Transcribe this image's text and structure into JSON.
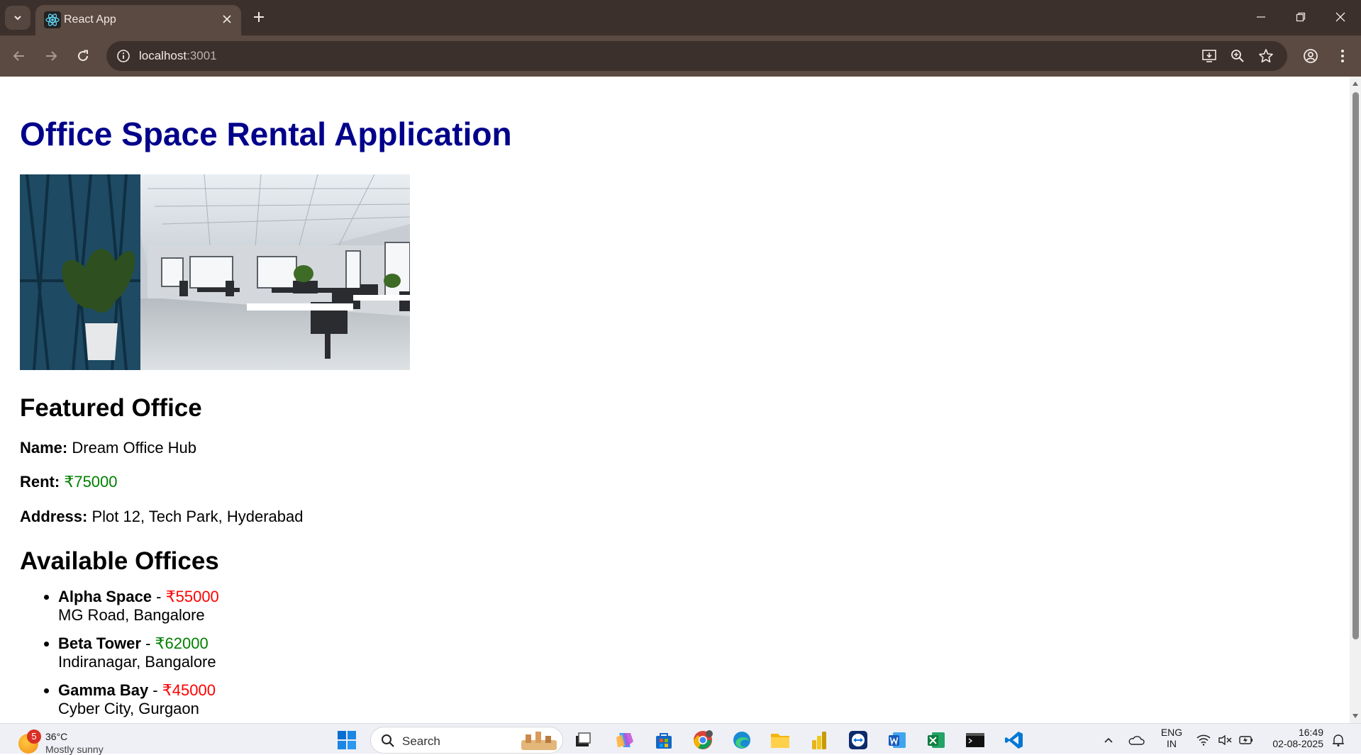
{
  "browser": {
    "tab_title": "React App",
    "url_host": "localhost",
    "url_port": ":3001"
  },
  "page": {
    "title": "Office Space Rental Application",
    "featured_heading": "Featured Office",
    "featured": {
      "name_label": "Name:",
      "name": "Dream Office Hub",
      "rent_label": "Rent:",
      "rent": "₹75000",
      "address_label": "Address:",
      "address": "Plot 12, Tech Park, Hyderabad"
    },
    "available_heading": "Available Offices",
    "offices": [
      {
        "name": "Alpha Space",
        "separator": " - ",
        "rent": "₹55000",
        "address": "MG Road, Bangalore",
        "rent_color": "#ff0000"
      },
      {
        "name": "Beta Tower",
        "separator": " - ",
        "rent": "₹62000",
        "address": "Indiranagar, Bangalore",
        "rent_color": "#008000"
      },
      {
        "name": "Gamma Bay",
        "separator": " - ",
        "rent": "₹45000",
        "address": "Cyber City, Gurgaon",
        "rent_color": "#ff0000"
      }
    ]
  },
  "taskbar": {
    "weather_badge": "5",
    "weather_temp": "36°C",
    "weather_desc": "Mostly sunny",
    "search_placeholder": "Search",
    "lang_line1": "ENG",
    "lang_line2": "IN",
    "time": "16:49",
    "date": "02-08-2025"
  },
  "colors": {
    "title": "#00008b",
    "rent_green": "#008000",
    "rent_red": "#ff0000",
    "browser_frame": "#3c302c",
    "browser_toolbar": "#5a4a42"
  }
}
